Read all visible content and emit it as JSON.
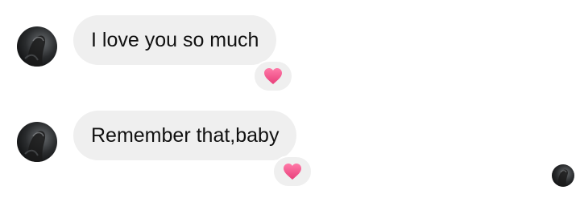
{
  "messages": [
    {
      "text": "I love you so much",
      "reaction": "heart-emoji"
    },
    {
      "text": "Remember that,baby",
      "reaction": "heart-emoji"
    }
  ],
  "colors": {
    "bubble_background": "#efefef",
    "text": "#111111",
    "heart": "#f2548a"
  },
  "seen_indicator": {
    "icon": "avatar"
  }
}
